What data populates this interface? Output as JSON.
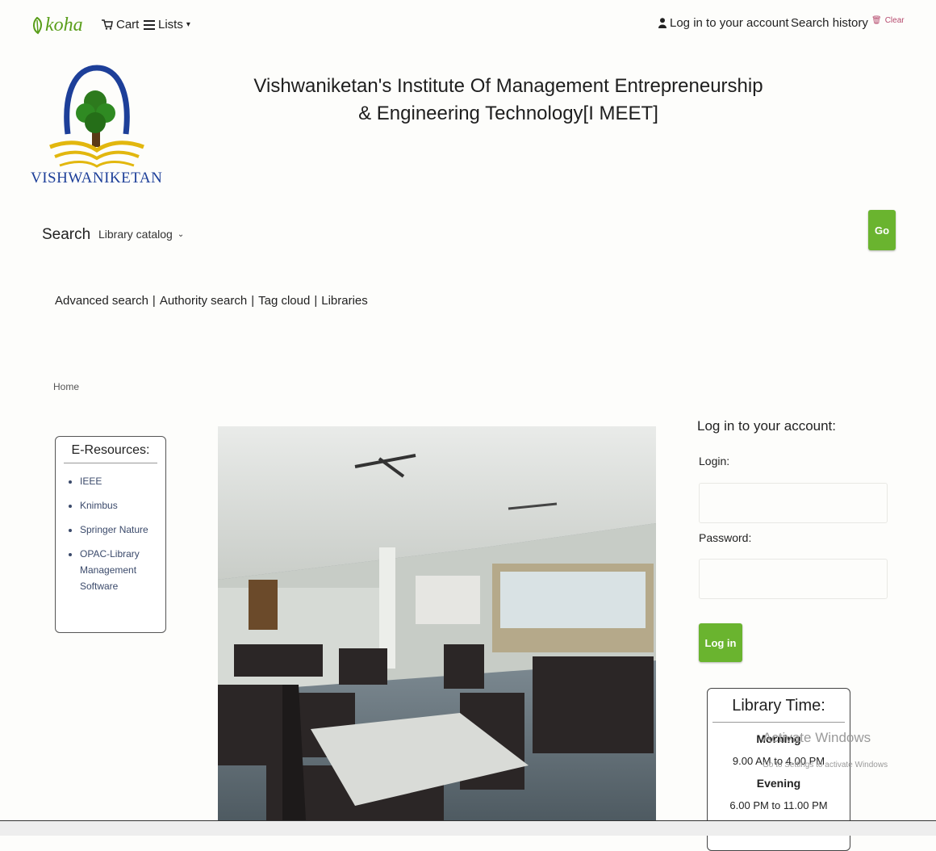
{
  "topnav": {
    "brand": "koha",
    "cart_label": "Cart",
    "lists_label": "Lists",
    "login_label": "Log in to your account",
    "search_history_label": "Search history",
    "clear_label": "Clear"
  },
  "header": {
    "title_line1": "Vishwaniketan's Institute Of Management Entrepreneurship",
    "title_line2": "& Engineering Technology[I MEET]",
    "logo_text": "VISHWANIKETAN"
  },
  "search": {
    "label": "Search",
    "scope": "Library catalog",
    "input_value": "",
    "go_label": "Go"
  },
  "links": [
    "Advanced search",
    "Authority search",
    "Tag cloud",
    "Libraries"
  ],
  "breadcrumb": "Home",
  "eresources": {
    "title": "E-Resources:",
    "items": [
      "IEEE",
      "Knimbus",
      "Springer Nature",
      "OPAC-Library Management Software"
    ]
  },
  "login": {
    "title": "Log in to your account:",
    "login_label": "Login:",
    "password_label": "Password:",
    "button": "Log in"
  },
  "library_time": {
    "title": "Library Time:",
    "morning_label": "Morning",
    "morning_hours": "9.00 AM to 4.00 PM",
    "evening_label": "Evening",
    "evening_hours": "6.00 PM to 11.00 PM"
  },
  "watermark": {
    "line1": "Activate Windows",
    "line2": "Go to Settings to activate Windows"
  },
  "colors": {
    "accent": "#6ab42f",
    "koha_green": "#5a9e1b"
  }
}
